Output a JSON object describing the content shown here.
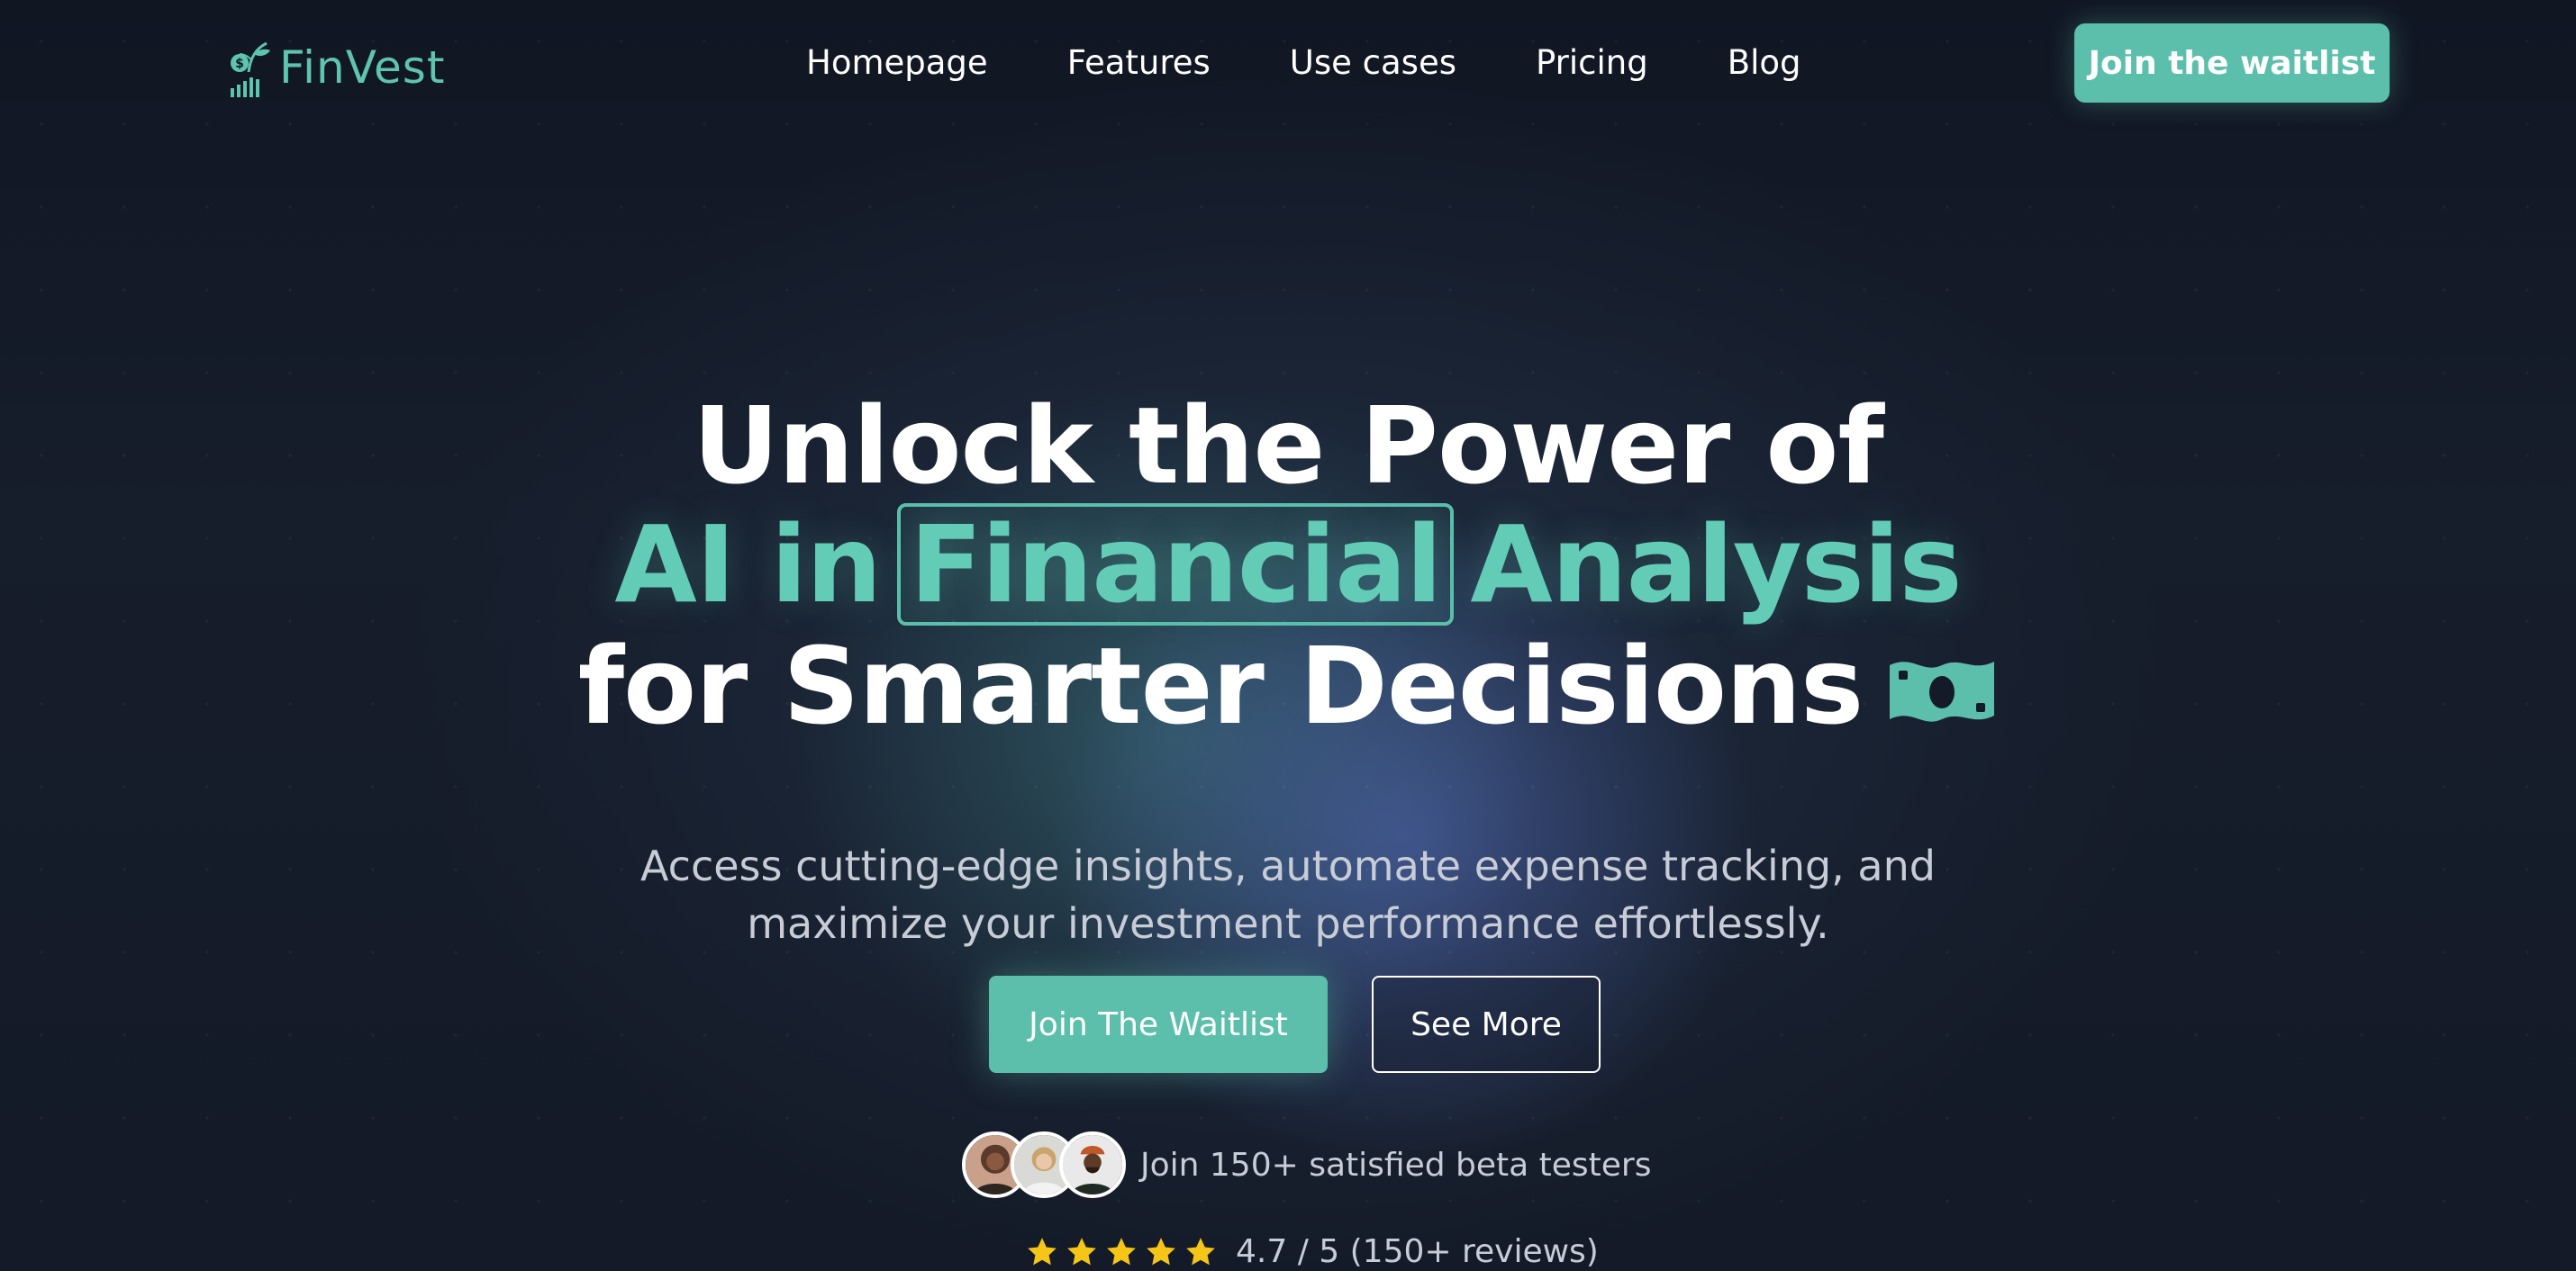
{
  "brand": {
    "name": "FinVest"
  },
  "nav": {
    "links": [
      "Homepage",
      "Features",
      "Use cases",
      "Pricing",
      "Blog"
    ],
    "cta": "Join the waitlist"
  },
  "hero": {
    "headline_line1": "Unlock the Power of",
    "headline_line2_before": "AI in",
    "headline_line2_boxed": "Financial",
    "headline_line2_after": "Analysis",
    "headline_line3": "for Smarter Decisions",
    "subtext": "Access cutting-edge insights, automate expense tracking, and maximize your investment performance effortlessly.",
    "primary_cta": "Join The Waitlist",
    "secondary_cta": "See More",
    "testers_text": "Join 150+ satisfied beta testers",
    "rating_stars": 5,
    "rating_text": "4.7 / 5 (150+ reviews)"
  },
  "colors": {
    "background": "#141a27",
    "accent": "#5bbfab",
    "text": "#ffffff",
    "muted_text": "#c7ccd6",
    "star": "#f5c518"
  },
  "icons": [
    "finvest-logo-icon",
    "cash-icon",
    "star-icon"
  ]
}
